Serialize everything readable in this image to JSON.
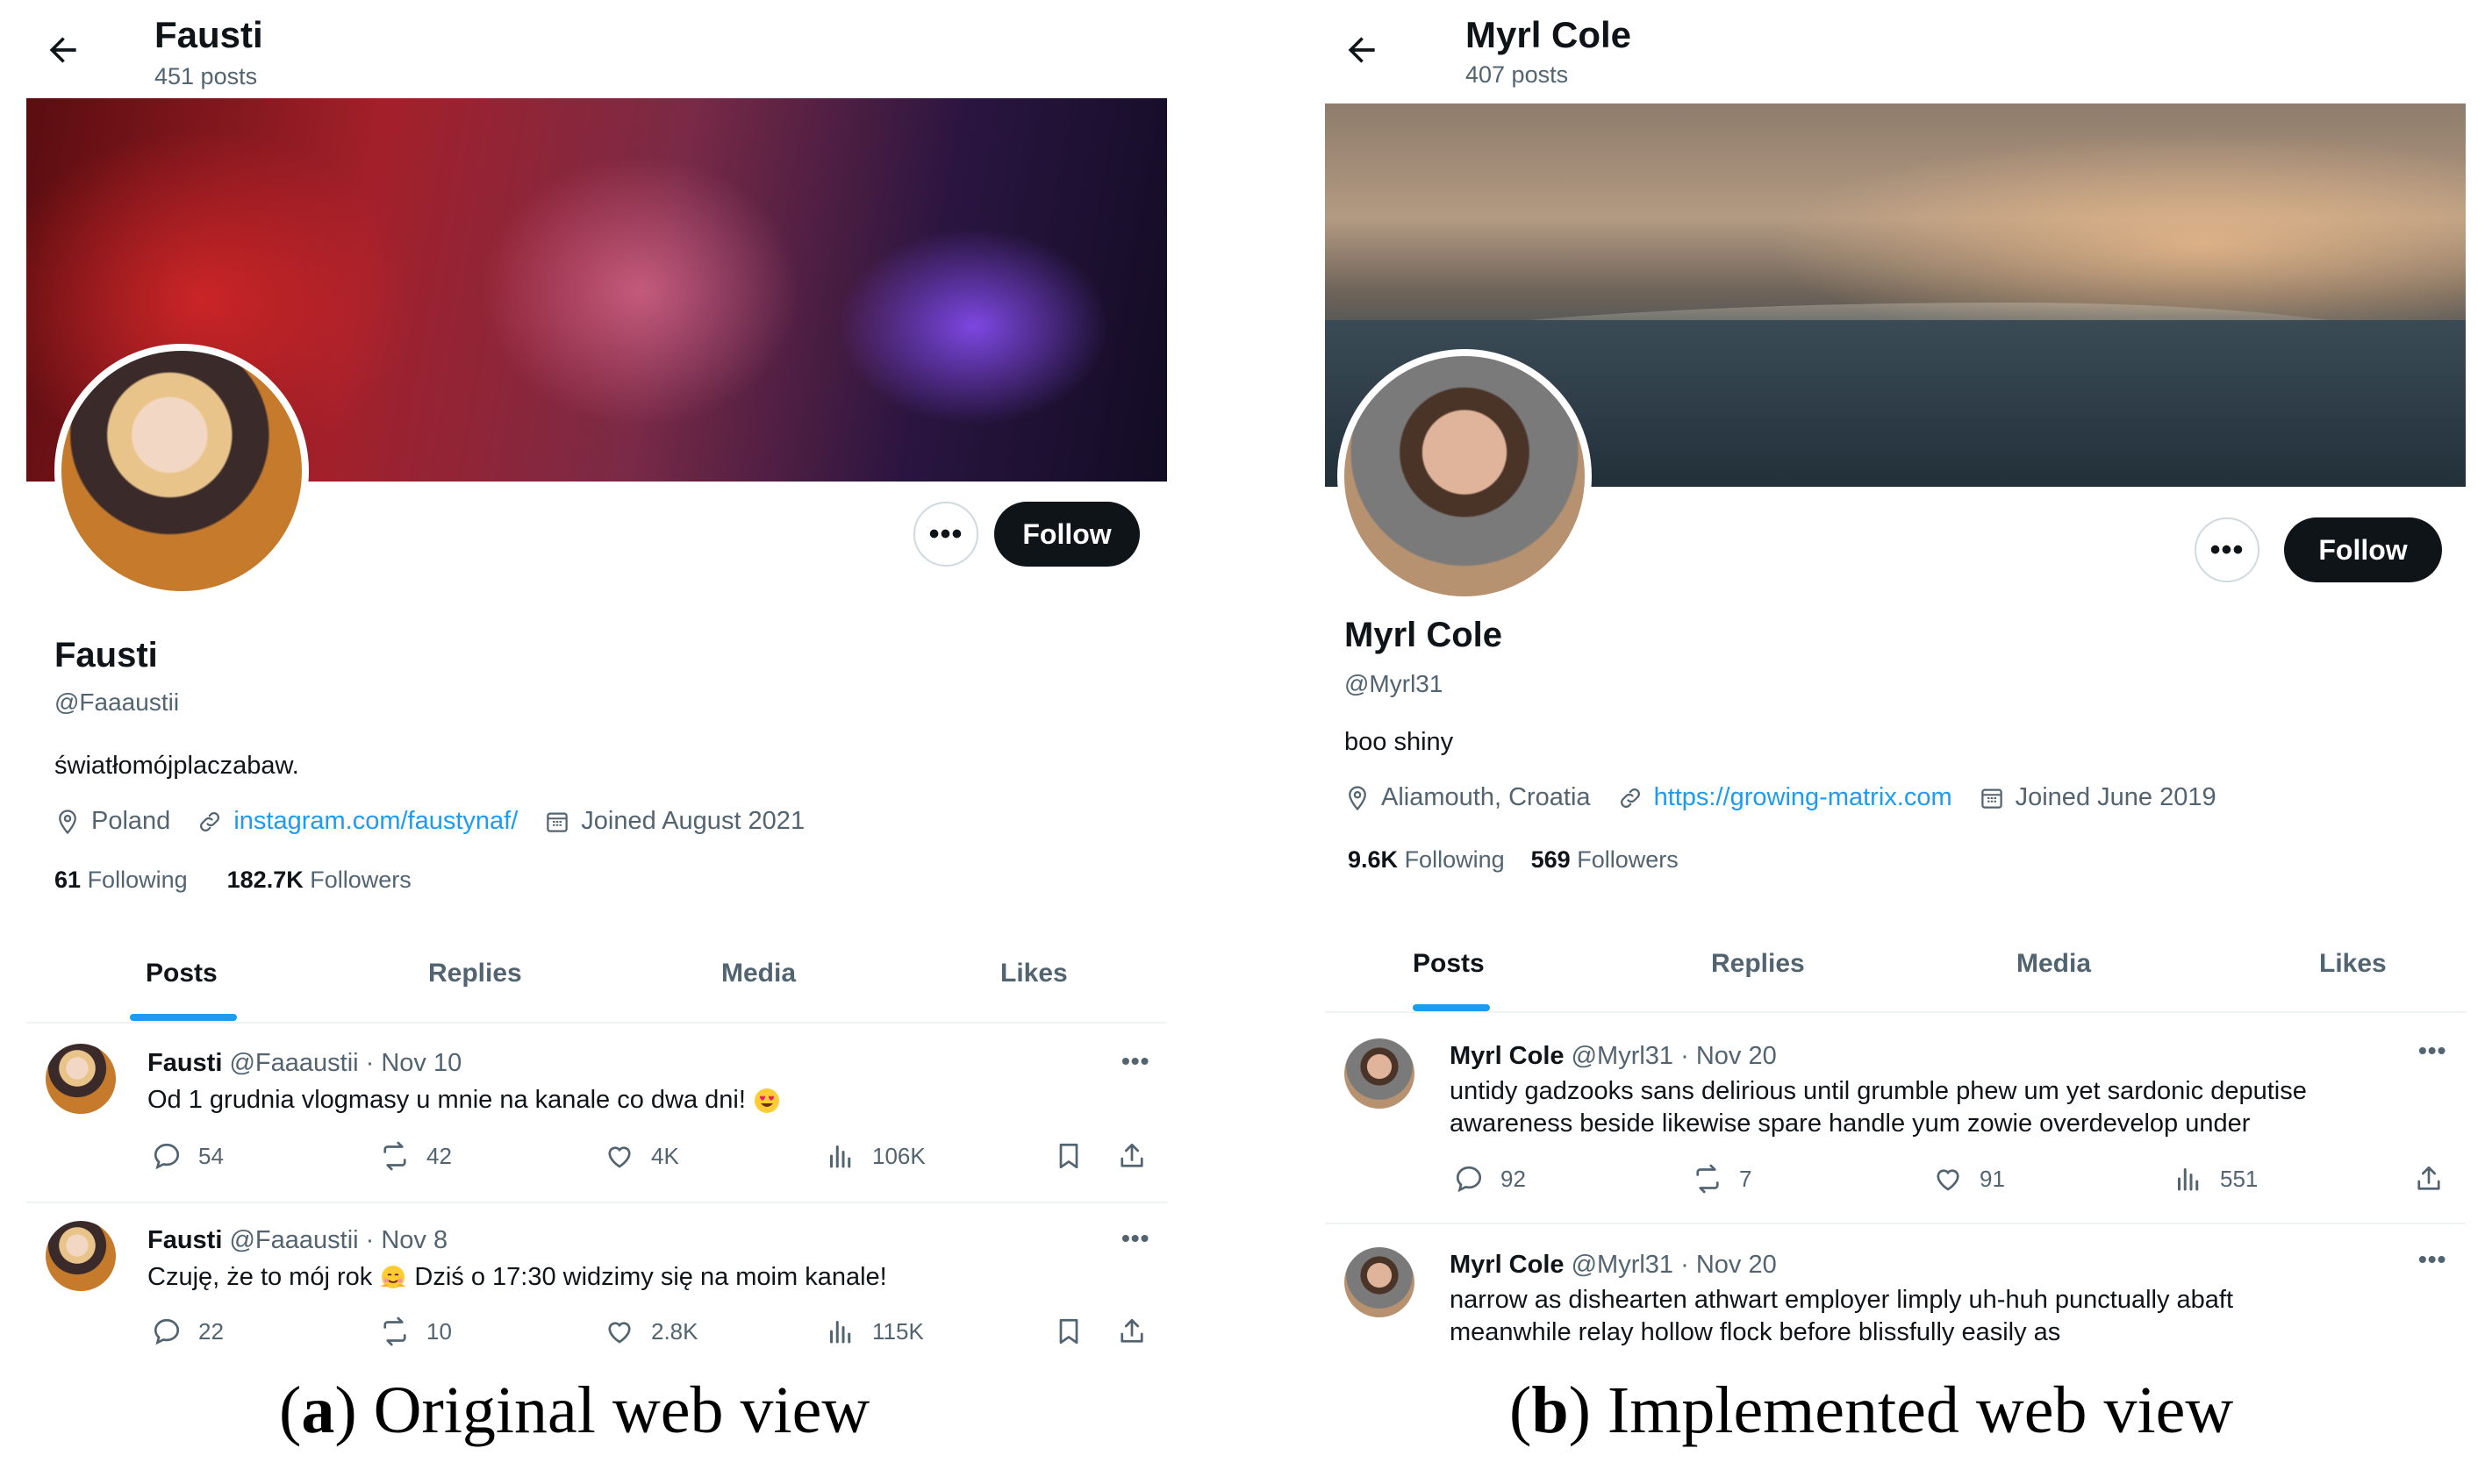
{
  "panel_a": {
    "topbar": {
      "name": "Fausti",
      "post_count": "451 posts"
    },
    "profile": {
      "name": "Fausti",
      "handle": "@Faaaustii",
      "bio": "światłomójplaczabaw.",
      "location": "Poland",
      "link": "instagram.com/faustynaf/",
      "joined": "Joined August 2021",
      "following_count": "61",
      "following_label": "Following",
      "followers_count": "182.7K",
      "followers_label": "Followers"
    },
    "follow_label": "Follow",
    "tabs": [
      "Posts",
      "Replies",
      "Media",
      "Likes"
    ],
    "posts": [
      {
        "name": "Fausti",
        "meta": "@Faaaustii · Nov 10",
        "text": "Od 1 grudnia vlogmasy u mnie na kanale co dwa dni!",
        "replies": "54",
        "reposts": "42",
        "likes": "4K",
        "views": "106K"
      },
      {
        "name": "Fausti",
        "meta": "@Faaaustii · Nov 8",
        "text_before": "Czuję, że to mój rok",
        "text_after": "Dziś o 17:30 widzimy się na moim kanale!",
        "replies": "22",
        "reposts": "10",
        "likes": "2.8K",
        "views": "115K"
      }
    ]
  },
  "panel_b": {
    "topbar": {
      "name": "Myrl Cole",
      "post_count": "407 posts"
    },
    "profile": {
      "name": "Myrl Cole",
      "handle": "@Myrl31",
      "bio": "boo shiny",
      "location": "Aliamouth, Croatia",
      "link": "https://growing-matrix.com",
      "joined": "Joined June 2019",
      "following_count": "9.6K",
      "following_label": "Following",
      "followers_count": "569",
      "followers_label": "Followers"
    },
    "follow_label": "Follow",
    "tabs": [
      "Posts",
      "Replies",
      "Media",
      "Likes"
    ],
    "posts": [
      {
        "name": "Myrl Cole",
        "meta": "@Myrl31 · Nov 20",
        "line1": "untidy gadzooks sans delirious until grumble phew um yet sardonic deputise",
        "line2": "awareness beside likewise spare handle yum zowie overdevelop under",
        "replies": "92",
        "reposts": "7",
        "likes": "91",
        "views": "551"
      },
      {
        "name": "Myrl Cole",
        "meta": "@Myrl31 · Nov 20",
        "line1": "narrow as dishearten athwart employer limply uh-huh punctually abaft",
        "line2": "meanwhile relay hollow flock before blissfully easily as"
      }
    ]
  },
  "captions": {
    "a_letter": "(a)",
    "a_text": "Original web view",
    "b_letter": "(b)",
    "b_text": "Implemented web view"
  },
  "colors": {
    "accent": "#1d9bf0",
    "text": "#0f1419",
    "muted": "#536471",
    "button": "#0f1419"
  },
  "icons": [
    "back-arrow-icon",
    "location-pin-icon",
    "link-icon",
    "calendar-icon",
    "reply-icon",
    "repost-icon",
    "like-icon",
    "views-icon",
    "bookmark-icon",
    "share-icon",
    "more-icon"
  ]
}
